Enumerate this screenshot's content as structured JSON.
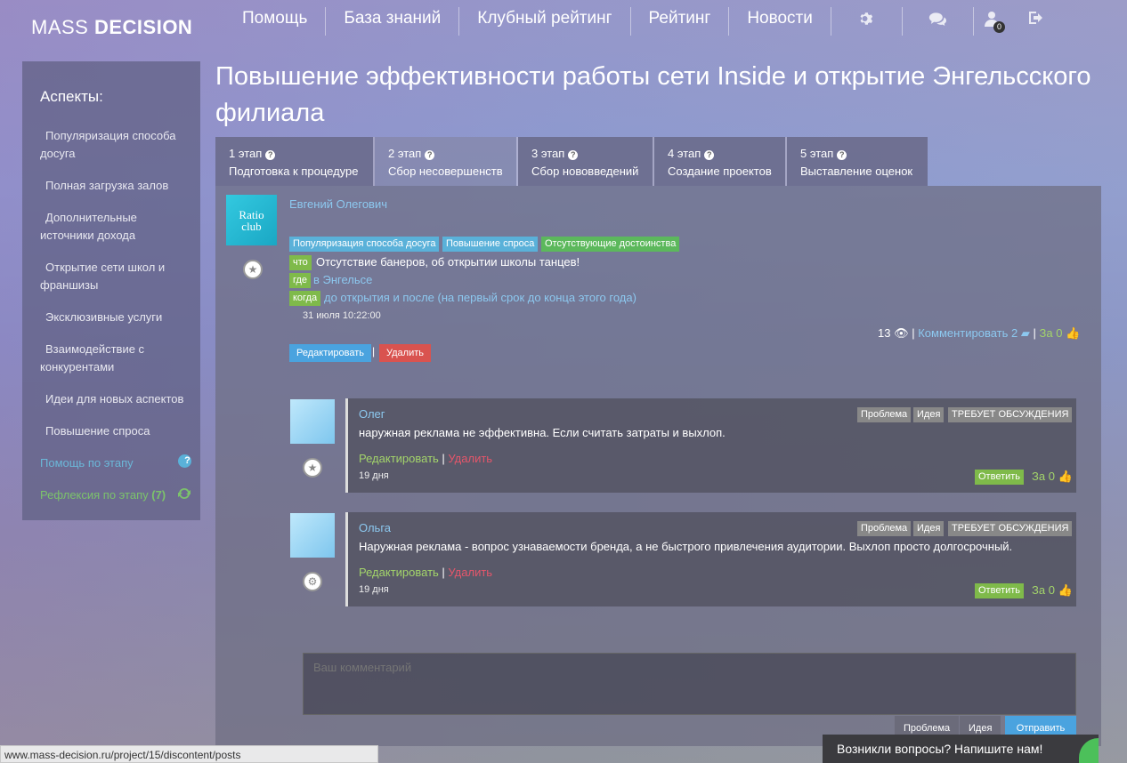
{
  "header": {
    "logo_light": "MASS ",
    "logo_bold": "DECISION",
    "nav": [
      "Помощь",
      "База знаний",
      "Клубный рейтинг",
      "Рейтинг",
      "Новости"
    ],
    "messages_count": "0"
  },
  "sidebar": {
    "title": "Аспекты:",
    "items": [
      "Популяризация способа досуга",
      "Полная загрузка залов",
      "Дополнительные источники дохода",
      "Открытие сети школ и франшизы",
      "Эксклюзивные услуги",
      "Взаимодействие с конкурентами",
      "Идеи для новых аспектов",
      "Повышение спроса"
    ],
    "help": "Помощь по этапу",
    "reflection": "Рефлексия по этапу",
    "reflection_count": "(7)"
  },
  "page": {
    "title": "Повышение эффективности работы сети Inside и открытие Энгельсского филиала"
  },
  "tabs": [
    {
      "step": "1 этап",
      "label": "Подготовка к процедуре"
    },
    {
      "step": "2 этап",
      "label": "Сбор несовершенств"
    },
    {
      "step": "3 этап",
      "label": "Сбор нововведений"
    },
    {
      "step": "4 этап",
      "label": "Создание проектов"
    },
    {
      "step": "5 этап",
      "label": "Выставление оценок"
    }
  ],
  "post": {
    "avatar_line1": "Ratio",
    "avatar_line2": "club",
    "author": "Евгений Олегович",
    "tags": [
      "Популяризация способа досуга",
      "Повышение спроса",
      "Отсутствующие достоинства"
    ],
    "what_label": "что",
    "what": "Отсутствие банеров, об открытии школы танцев!",
    "where_label": "где",
    "where": "в Энгельсе",
    "when_label": "когда",
    "when": "до открытия и после (на первый срок до конца этого года)",
    "date": "31 июля 10:22:00",
    "views": "13",
    "comment_link": "Комментировать 2",
    "vote": "За 0",
    "edit": "Редактировать",
    "delete": "Удалить"
  },
  "comments": [
    {
      "author": "Олег",
      "text": "наружная реклама не эффективна. Если считать затраты и выхлоп.",
      "tags": [
        "Проблема",
        "Идея",
        "ТРЕБУЕТ ОБСУЖДЕНИЯ"
      ],
      "edit": "Редактировать",
      "delete": "Удалить",
      "date": "19 дня",
      "reply": "Ответить",
      "vote": "За 0"
    },
    {
      "author": "Ольга",
      "text": "Наружная реклама - вопрос узнаваемости бренда, а не быстрого привлечения аудитории. Выхлоп просто долгосрочный.",
      "tags": [
        "Проблема",
        "Идея",
        "ТРЕБУЕТ ОБСУЖДЕНИЯ"
      ],
      "edit": "Редактировать",
      "delete": "Удалить",
      "date": "19 дня",
      "reply": "Ответить",
      "vote": "За 0"
    }
  ],
  "composer": {
    "placeholder": "Ваш комментарий",
    "btn_problem": "Проблема",
    "btn_idea": "Идея",
    "btn_send": "Отправить"
  },
  "status_url": "www.mass-decision.ru/project/15/discontent/posts",
  "chat": "Возникли вопросы? Напишите нам!",
  "colors": {
    "link": "#8cc8ef",
    "green": "#7fba4a",
    "red": "#d9534f",
    "blue": "#4aa3df"
  }
}
